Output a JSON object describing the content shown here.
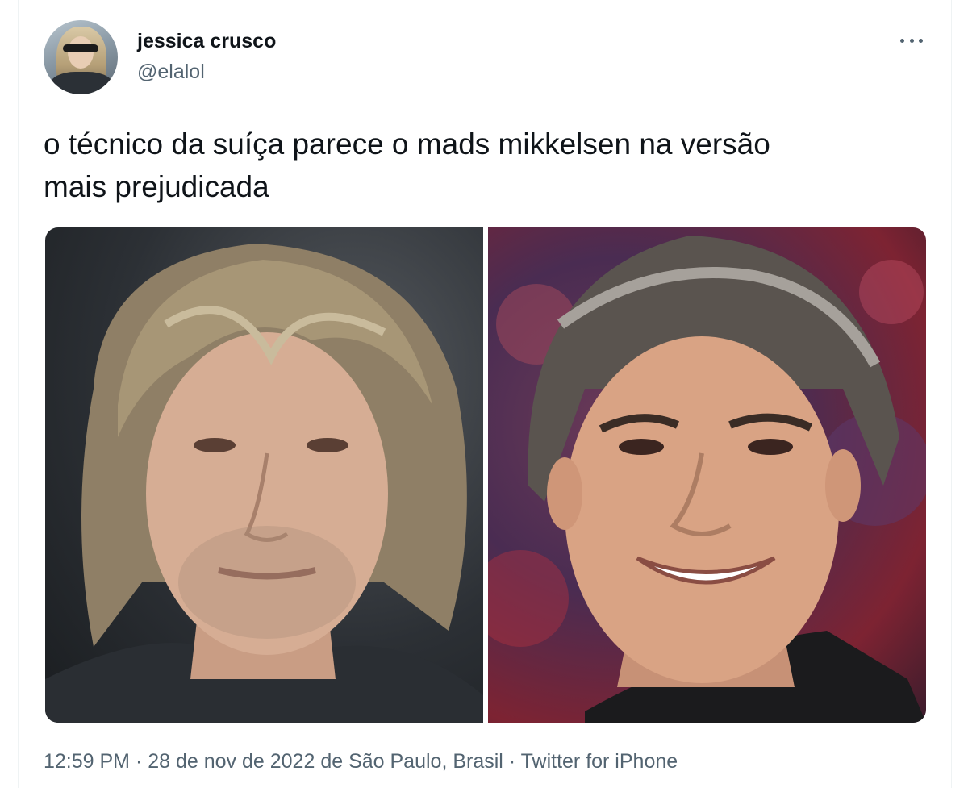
{
  "author": {
    "display_name": "jessica crusco",
    "handle": "@elalol"
  },
  "tweet": {
    "text": "o técnico da suíça parece o mads mikkelsen na versão\nmais prejudicada"
  },
  "meta": {
    "time": "12:59 PM",
    "separator": " · ",
    "date": "28 de nov de 2022",
    "location": " de São Paulo, Brasil",
    "source": "Twitter for iPhone"
  },
  "icons": {
    "more": "more-options-icon"
  }
}
